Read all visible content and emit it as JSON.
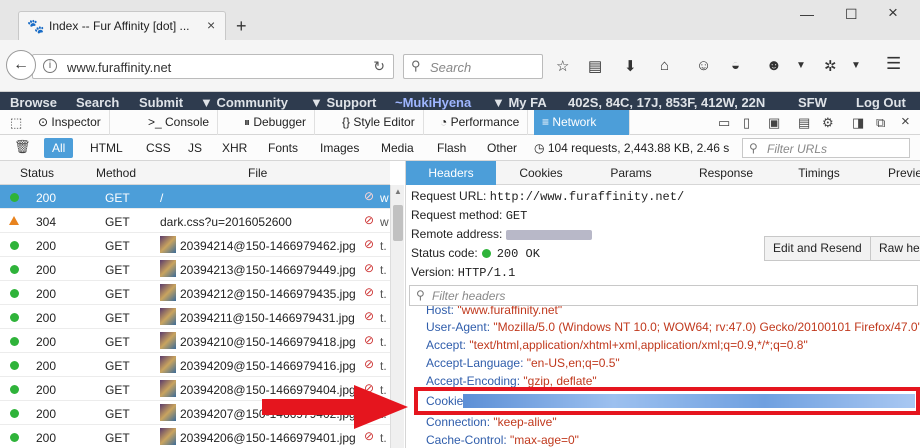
{
  "browser": {
    "tab_title": "Index -- Fur Affinity [dot] ...",
    "url": "www.furaffinity.net",
    "search_placeholder": "Search"
  },
  "site_nav": {
    "items": [
      "Browse",
      "Search",
      "Submit",
      "▼ Community",
      "▼ Support",
      "~MukiHyena",
      "▼ My FA",
      "402S, 84C, 17J, 853F, 412W, 22N",
      "SFW",
      "Log Out"
    ]
  },
  "devtools": {
    "tabs": [
      "Inspector",
      "Console",
      "Debugger",
      "Style Editor",
      "Performance",
      "Network"
    ],
    "active_tab": "Network",
    "filters": [
      "All",
      "HTML",
      "CSS",
      "JS",
      "XHR",
      "Fonts",
      "Images",
      "Media",
      "Flash",
      "Other"
    ],
    "summary": "104 requests, 2,443.88 KB, 2.46 s",
    "url_filter_placeholder": "Filter URLs",
    "columns": [
      "Status",
      "Method",
      "File"
    ],
    "requests": [
      {
        "status": "200",
        "method": "GET",
        "file": "/",
        "ext": "w",
        "selected": true,
        "kind": "ok"
      },
      {
        "status": "304",
        "method": "GET",
        "file": "dark.css?u=2016052600",
        "ext": "w",
        "selected": false,
        "kind": "warn"
      },
      {
        "status": "200",
        "method": "GET",
        "file": "20394214@150-1466979462.jpg",
        "ext": "t.",
        "selected": false,
        "kind": "ok"
      },
      {
        "status": "200",
        "method": "GET",
        "file": "20394213@150-1466979449.jpg",
        "ext": "t.",
        "selected": false,
        "kind": "ok"
      },
      {
        "status": "200",
        "method": "GET",
        "file": "20394212@150-1466979435.jpg",
        "ext": "t.",
        "selected": false,
        "kind": "ok"
      },
      {
        "status": "200",
        "method": "GET",
        "file": "20394211@150-1466979431.jpg",
        "ext": "t.",
        "selected": false,
        "kind": "ok"
      },
      {
        "status": "200",
        "method": "GET",
        "file": "20394210@150-1466979418.jpg",
        "ext": "t.",
        "selected": false,
        "kind": "ok"
      },
      {
        "status": "200",
        "method": "GET",
        "file": "20394209@150-1466979416.jpg",
        "ext": "t.",
        "selected": false,
        "kind": "ok"
      },
      {
        "status": "200",
        "method": "GET",
        "file": "20394208@150-1466979404.jpg",
        "ext": "t.",
        "selected": false,
        "kind": "ok"
      },
      {
        "status": "200",
        "method": "GET",
        "file": "20394207@150-1466979402.jpg",
        "ext": "t.",
        "selected": false,
        "kind": "ok"
      },
      {
        "status": "200",
        "method": "GET",
        "file": "20394206@150-1466979401.jpg",
        "ext": "t.",
        "selected": false,
        "kind": "ok"
      }
    ]
  },
  "details": {
    "tabs": [
      "Headers",
      "Cookies",
      "Params",
      "Response",
      "Timings",
      "Previe"
    ],
    "active_tab": "Headers",
    "request_url_label": "Request URL:",
    "request_url": "http://www.furaffinity.net/",
    "method_label": "Request method:",
    "method": "GET",
    "remote_label": "Remote address:",
    "status_label": "Status code:",
    "status": "200 OK",
    "version_label": "Version:",
    "version": "HTTP/1.1",
    "edit_resend": "Edit and Resend",
    "raw_headers": "Raw hea",
    "header_filter_placeholder": "Filter headers",
    "headers": [
      {
        "name": "Host:",
        "value": "\"www.furaffinity.net\""
      },
      {
        "name": "User-Agent:",
        "value": "\"Mozilla/5.0 (Windows NT 10.0; WOW64; rv:47.0) Gecko/20100101 Firefox/47.0\""
      },
      {
        "name": "Accept:",
        "value": "\"text/html,application/xhtml+xml,application/xml;q=0.9,*/*;q=0.8\""
      },
      {
        "name": "Accept-Language:",
        "value": "\"en-US,en;q=0.5\""
      },
      {
        "name": "Accept-Encoding:",
        "value": "\"gzip, deflate\""
      },
      {
        "name": "Cookie:",
        "value": ""
      },
      {
        "name": "Connection:",
        "value": "\"keep-alive\""
      },
      {
        "name": "Cache-Control:",
        "value": "\"max-age=0\""
      }
    ]
  },
  "colors": {
    "accent": "#4c9ed9",
    "highlight_box": "#e5151e",
    "arrow": "#e5151e"
  }
}
